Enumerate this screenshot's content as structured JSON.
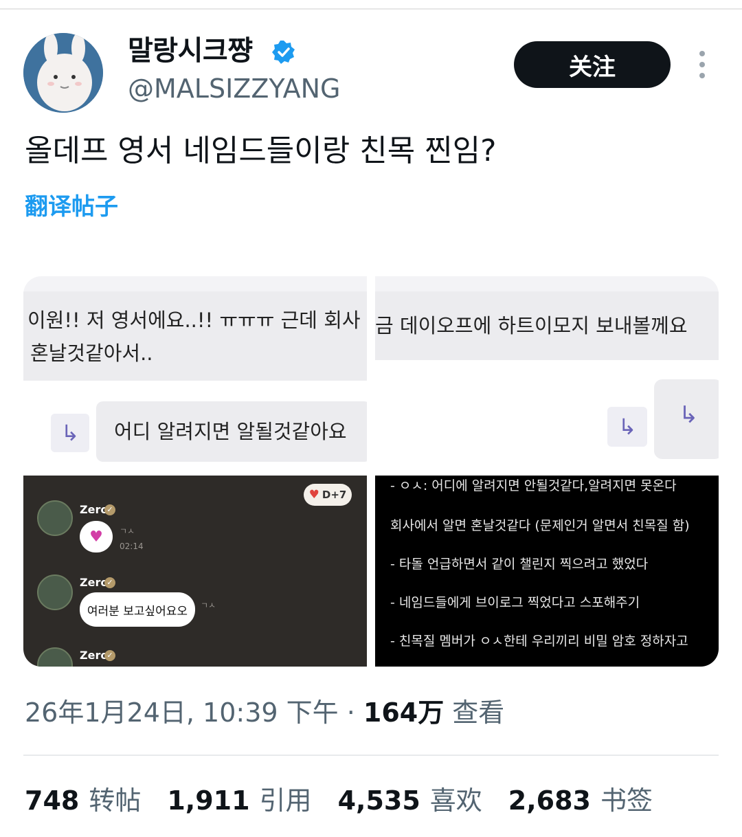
{
  "author": {
    "name": "말랑시크쨩",
    "handle": "@MALSIZZYANG"
  },
  "follow_label": "关注",
  "tweet_text": "올데프 영서 네임드들이랑 친목 찐임?",
  "translate_label": "翻译帖子",
  "media": {
    "tile1": {
      "line1": "이원!! 저 영서에요..!! ㅠㅠㅠ 근데 회사",
      "line2": "혼날것같아서..",
      "reply": "어디 알려지면 알될것같아요"
    },
    "tile2": {
      "line1": "금 데이오프에 하트이모지 보내볼께요"
    },
    "tile3": {
      "badge": "D+7",
      "sender": "Zero",
      "time": "02:14",
      "message2": "여러분 보고싶어요오"
    },
    "tile4": {
      "lines": [
        "- ㅇㅅ: 어디에 알려지면 안될것같다,알려지면 못온다",
        "회사에서 알면 혼날것같다 (문제인거 알면서 친목질 함)",
        "- 타돌 언급하면서 같이 챌린지 찍으려고 했었다",
        "- 네임드들에게 브이로그 찍었다고 스포해주기",
        "- 친목질 멤버가 ㅇㅅ한테 우리끼리 비밀 암호 정하자고"
      ]
    }
  },
  "meta": {
    "datetime": "26年1月24日, 10:39 下午",
    "separator": " · ",
    "views_count": "164万",
    "views_label": " 查看"
  },
  "stats": [
    {
      "num": "748",
      "label": "转帖"
    },
    {
      "num": "1,911",
      "label": "引用"
    },
    {
      "num": "4,535",
      "label": "喜欢"
    },
    {
      "num": "2,683",
      "label": "书签"
    }
  ],
  "colors": {
    "link": "#1d9bf0",
    "verified": "#1d9bf0",
    "follow_bg": "#0f1419"
  }
}
